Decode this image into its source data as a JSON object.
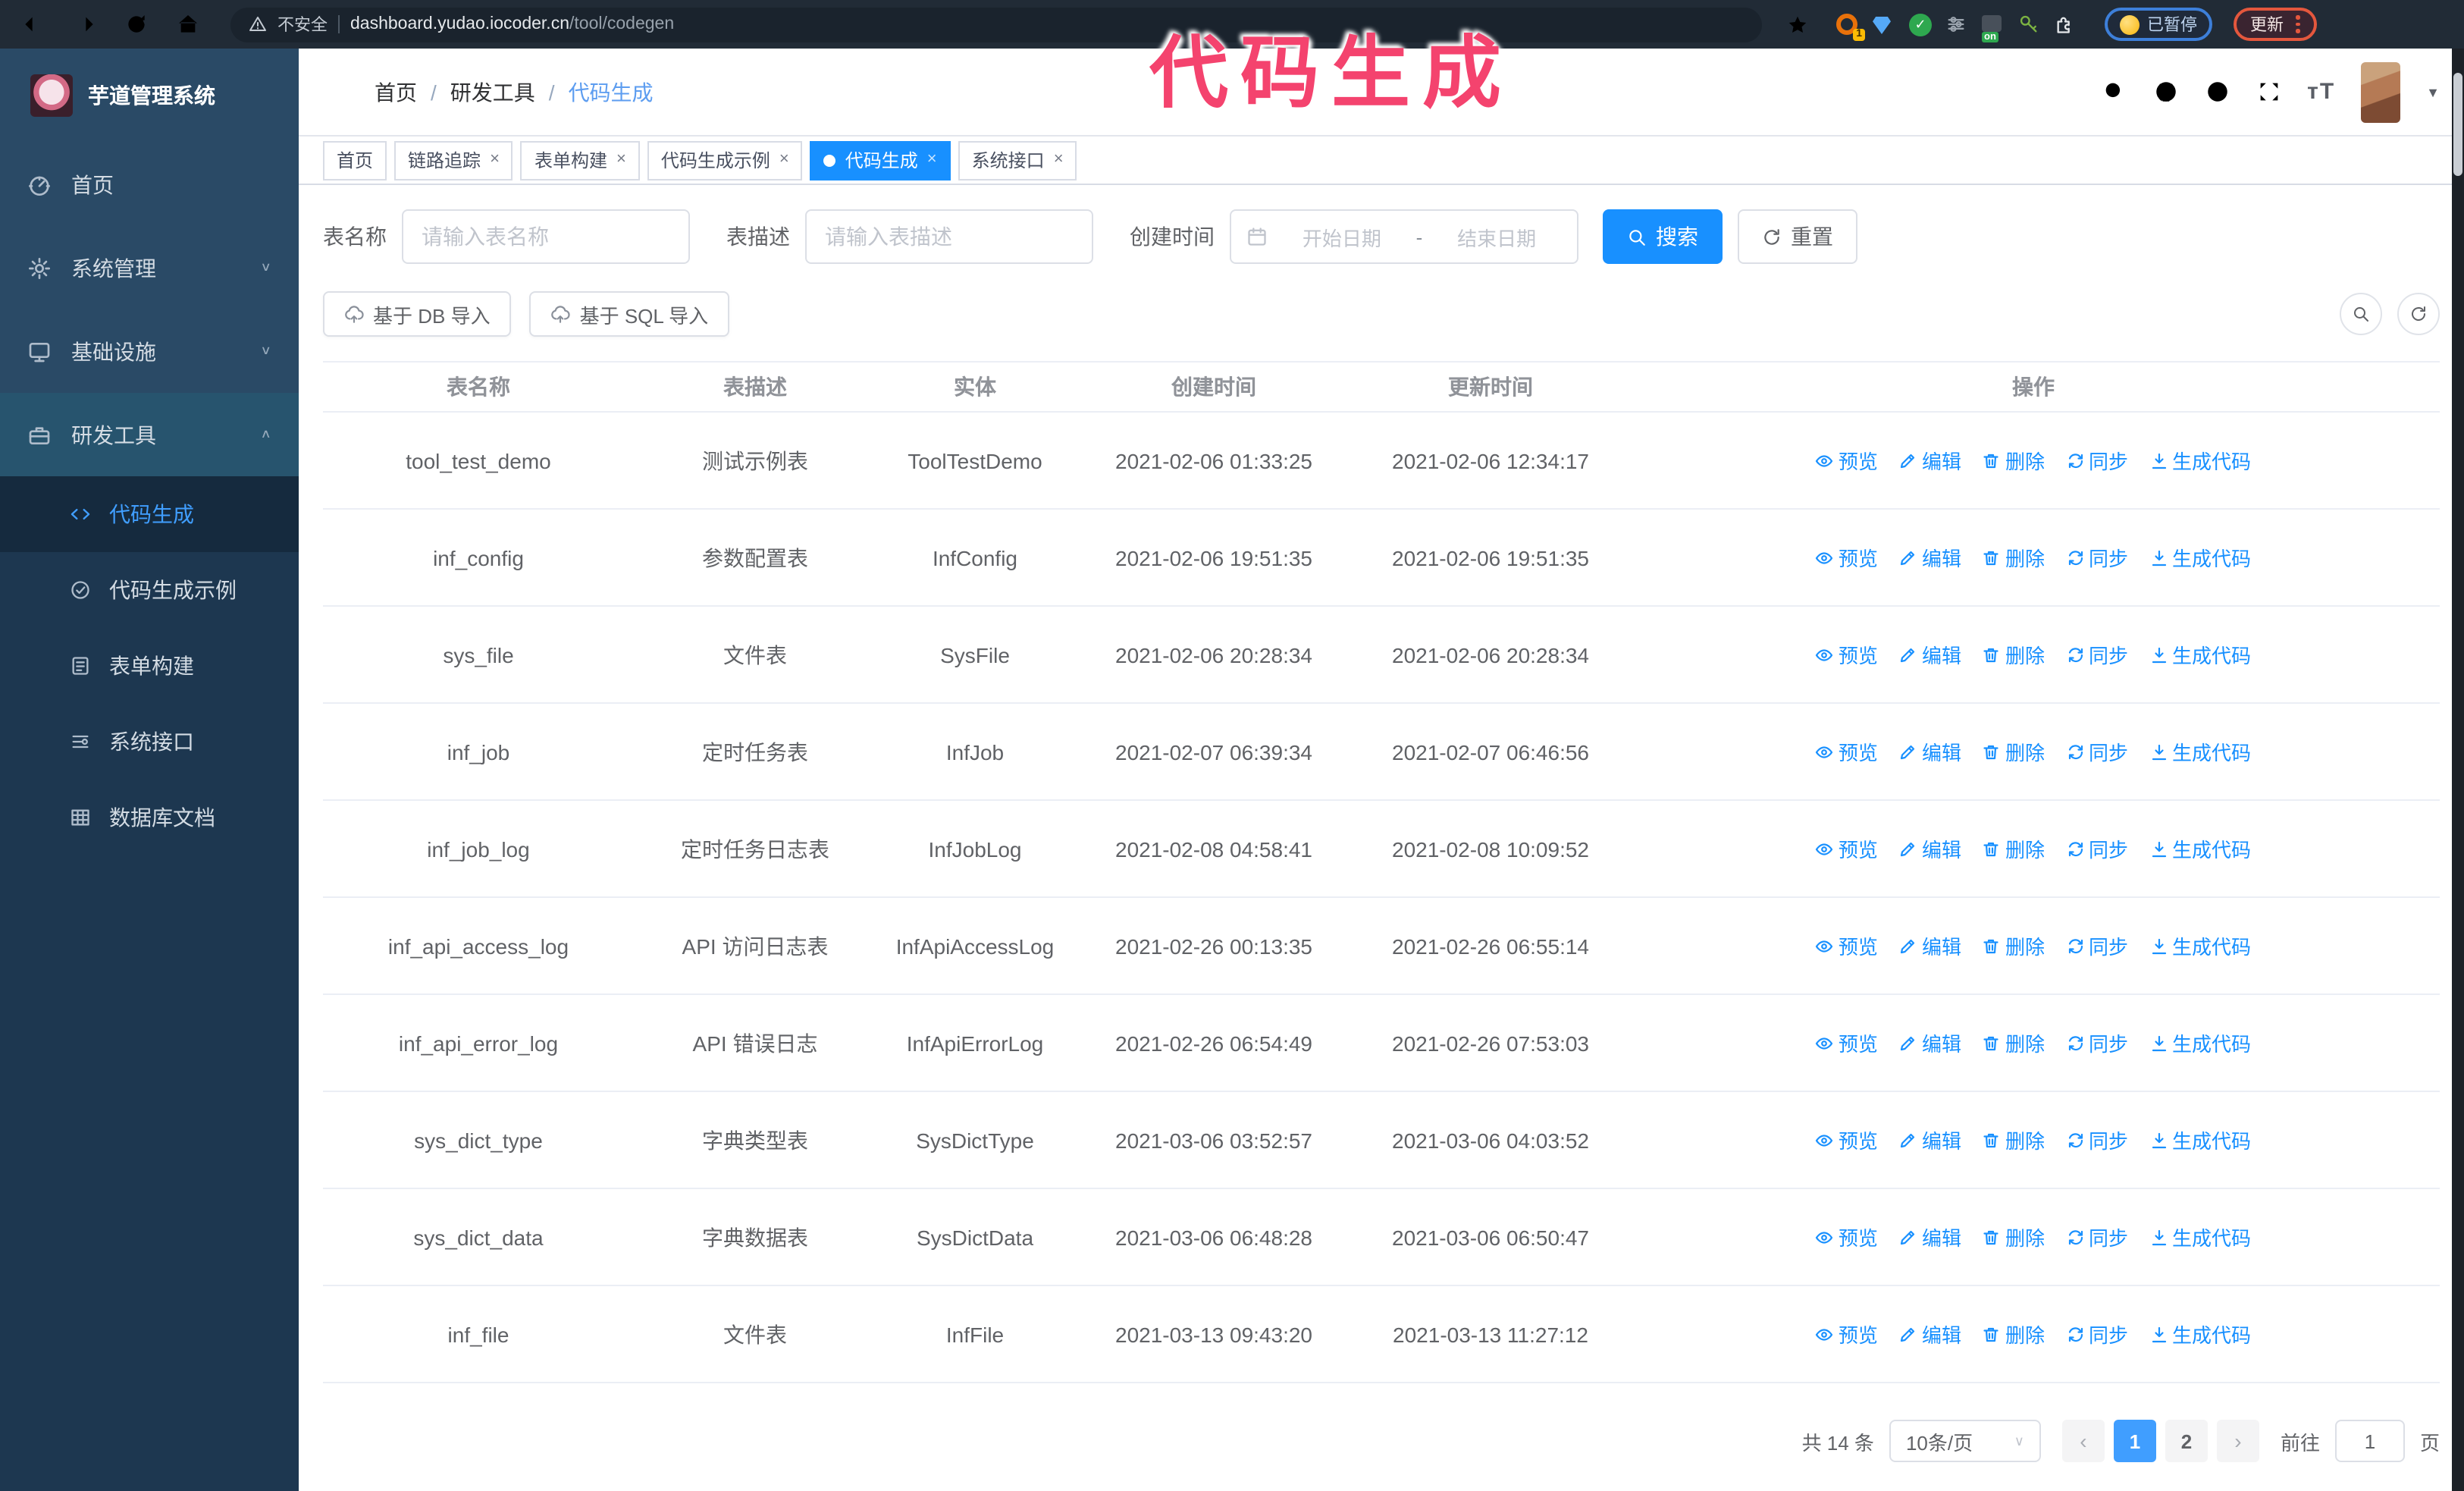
{
  "browser": {
    "security_label": "不安全",
    "url_host": "dashboard.yudao.iocoder.cn",
    "url_path": "/tool/codegen",
    "extension_badge": "1",
    "extension_on_badge": "on",
    "paused_badge": "已暂停",
    "update_button": "更新"
  },
  "annotation": {
    "text": "代码生成",
    "color": "#f4436e"
  },
  "sidebar": {
    "logo_title": "芋道管理系统",
    "menu": [
      {
        "label": "首页"
      },
      {
        "label": "系统管理",
        "chevron": "down"
      },
      {
        "label": "基础设施",
        "chevron": "down"
      },
      {
        "label": "研发工具",
        "chevron": "up",
        "expanded": true
      }
    ],
    "submenu": [
      {
        "label": "代码生成",
        "active": true
      },
      {
        "label": "代码生成示例"
      },
      {
        "label": "表单构建"
      },
      {
        "label": "系统接口"
      },
      {
        "label": "数据库文档"
      }
    ]
  },
  "header": {
    "breadcrumb": [
      "首页",
      "研发工具",
      "代码生成"
    ]
  },
  "tabs": [
    {
      "label": "首页"
    },
    {
      "label": "链路追踪"
    },
    {
      "label": "表单构建"
    },
    {
      "label": "代码生成示例"
    },
    {
      "label": "代码生成",
      "active": true
    },
    {
      "label": "系统接口"
    }
  ],
  "filters": {
    "table_name_label": "表名称",
    "table_name_placeholder": "请输入表名称",
    "table_desc_label": "表描述",
    "table_desc_placeholder": "请输入表描述",
    "create_time_label": "创建时间",
    "date_start_placeholder": "开始日期",
    "date_separator": "-",
    "date_end_placeholder": "结束日期",
    "search_button": "搜索",
    "reset_button": "重置"
  },
  "toolbar": {
    "import_db_button": "基于 DB 导入",
    "import_sql_button": "基于 SQL 导入"
  },
  "table": {
    "columns": [
      "表名称",
      "表描述",
      "实体",
      "创建时间",
      "更新时间",
      "操作"
    ],
    "actions": [
      "预览",
      "编辑",
      "删除",
      "同步",
      "生成代码"
    ],
    "rows": [
      {
        "name": "tool_test_demo",
        "desc": "测试示例表",
        "entity": "ToolTestDemo",
        "created": "2021-02-06 01:33:25",
        "updated": "2021-02-06 12:34:17"
      },
      {
        "name": "inf_config",
        "desc": "参数配置表",
        "entity": "InfConfig",
        "created": "2021-02-06 19:51:35",
        "updated": "2021-02-06 19:51:35"
      },
      {
        "name": "sys_file",
        "desc": "文件表",
        "entity": "SysFile",
        "created": "2021-02-06 20:28:34",
        "updated": "2021-02-06 20:28:34"
      },
      {
        "name": "inf_job",
        "desc": "定时任务表",
        "entity": "InfJob",
        "created": "2021-02-07 06:39:34",
        "updated": "2021-02-07 06:46:56"
      },
      {
        "name": "inf_job_log",
        "desc": "定时任务日志表",
        "entity": "InfJobLog",
        "created": "2021-02-08 04:58:41",
        "updated": "2021-02-08 10:09:52"
      },
      {
        "name": "inf_api_access_log",
        "desc": "API 访问日志表",
        "entity": "InfApiAccessLog",
        "created": "2021-02-26 00:13:35",
        "updated": "2021-02-26 06:55:14"
      },
      {
        "name": "inf_api_error_log",
        "desc": "API 错误日志",
        "entity": "InfApiErrorLog",
        "created": "2021-02-26 06:54:49",
        "updated": "2021-02-26 07:53:03"
      },
      {
        "name": "sys_dict_type",
        "desc": "字典类型表",
        "entity": "SysDictType",
        "created": "2021-03-06 03:52:57",
        "updated": "2021-03-06 04:03:52"
      },
      {
        "name": "sys_dict_data",
        "desc": "字典数据表",
        "entity": "SysDictData",
        "created": "2021-03-06 06:48:28",
        "updated": "2021-03-06 06:50:47"
      },
      {
        "name": "inf_file",
        "desc": "文件表",
        "entity": "InfFile",
        "created": "2021-03-13 09:43:20",
        "updated": "2021-03-13 11:27:12"
      }
    ]
  },
  "pagination": {
    "total_label": "共 14 条",
    "page_size": "10条/页",
    "prev": "‹",
    "next": "›",
    "pages": [
      "1",
      "2"
    ],
    "active_page": "1",
    "goto_label": "前往",
    "goto_value": "1",
    "goto_suffix": "页"
  },
  "colors": {
    "primary": "#1890ff",
    "page_active": "#409eff",
    "annotation_pink": "#f4436e",
    "sidebar_bg": "#2a4a66",
    "submenu_bg": "#1d3750",
    "chrome_bar": "#212b36"
  }
}
